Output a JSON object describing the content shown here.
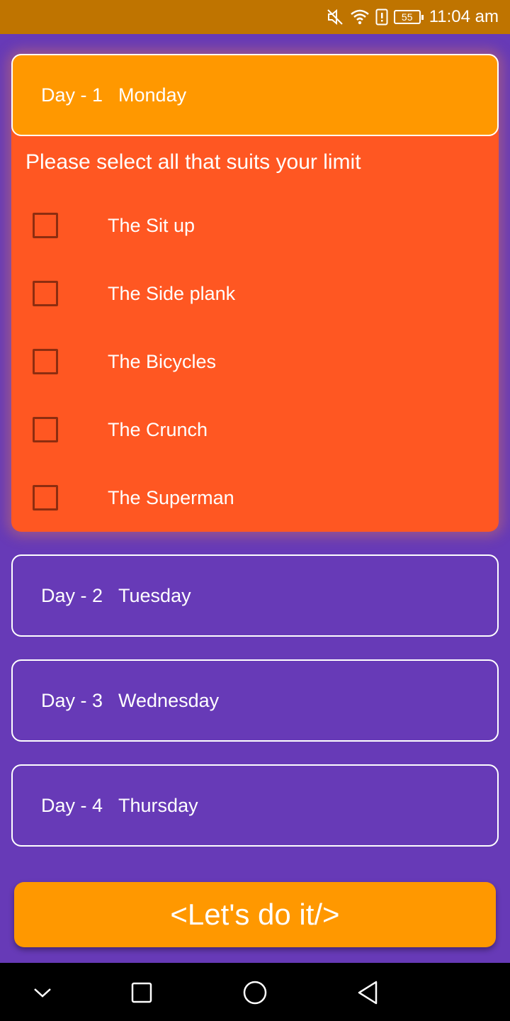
{
  "status_bar": {
    "time": "11:04 am",
    "battery": "55",
    "icons": [
      "mute-icon",
      "wifi-icon",
      "alert-icon",
      "battery-icon"
    ]
  },
  "days": [
    {
      "num": "Day - 1",
      "name": "Monday"
    },
    {
      "num": "Day - 2",
      "name": "Tuesday"
    },
    {
      "num": "Day - 3",
      "name": "Wednesday"
    },
    {
      "num": "Day - 4",
      "name": "Thursday"
    }
  ],
  "expanded": {
    "prompt": "Please select all that suits your limit",
    "exercises": [
      {
        "label": "The Sit up",
        "checked": false
      },
      {
        "label": "The Side plank",
        "checked": false
      },
      {
        "label": "The Bicycles",
        "checked": false
      },
      {
        "label": "The Crunch",
        "checked": false
      },
      {
        "label": "The Superman",
        "checked": false
      }
    ]
  },
  "cta_label": "<Let's do it/>",
  "nav": [
    "chevron-down-icon",
    "square-icon",
    "circle-icon",
    "back-triangle-icon"
  ],
  "colors": {
    "background": "#673ab7",
    "status_bar": "#bf7400",
    "accent_orange": "#ff9800",
    "expanded_body": "#ff5722",
    "checkbox_border": "#8d2d10"
  }
}
